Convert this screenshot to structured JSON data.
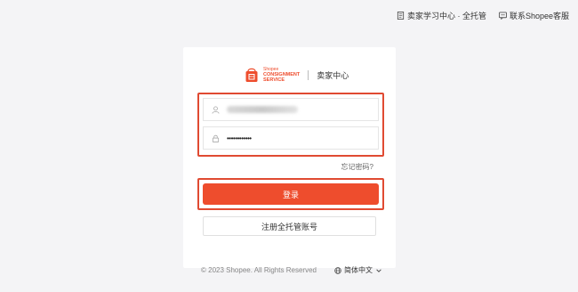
{
  "topbar": {
    "academy": "卖家学习中心 · 全托管",
    "support": "联系Shopee客服"
  },
  "brand": {
    "logo_small": "Shopee",
    "logo_line1": "CONSIGNMENT",
    "logo_line2": "SERVICE",
    "title": "卖家中心"
  },
  "form": {
    "username_value": "",
    "password_value": "••••••••••••",
    "forgot": "忘记密码?",
    "login": "登录",
    "register": "注册全托管账号"
  },
  "footer": {
    "copyright": "© 2023 Shopee. All Rights Reserved",
    "language": "简体中文"
  },
  "colors": {
    "accent": "#ee4d2d",
    "highlight": "#e04a32"
  }
}
